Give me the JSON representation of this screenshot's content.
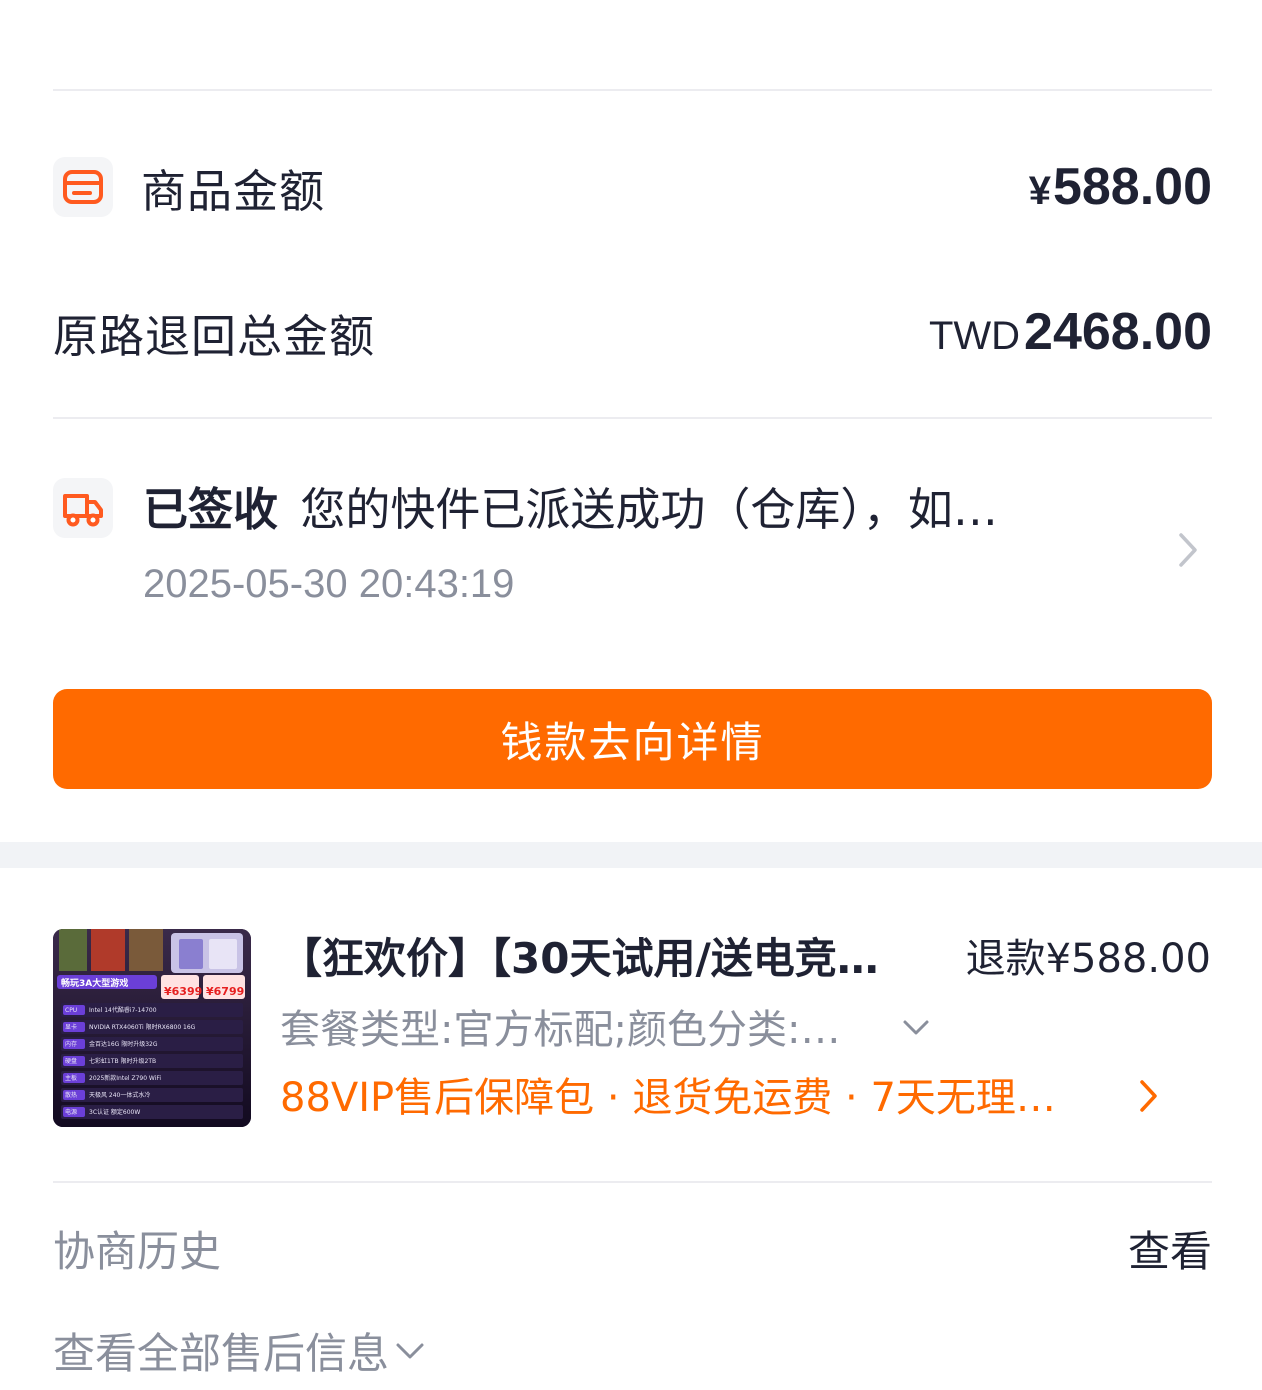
{
  "summary": {
    "goods_amount_label": "商品金额",
    "goods_amount_symbol": "¥",
    "goods_amount_value": "588.00",
    "refund_total_label": "原路退回总金额",
    "refund_total_currency": "TWD",
    "refund_total_value": "2468.00"
  },
  "logistics": {
    "status": "已签收",
    "message": "您的快件已派送成功（仓库），如…",
    "timestamp": "2025-05-30 20:43:19"
  },
  "money_flow_button": "钱款去向详情",
  "product": {
    "title": "【狂欢价】【30天试用/送电竞…",
    "refund": "退款¥588.00",
    "spec": "套餐类型:官方标配;颜色分类:配…",
    "service": "88VIP售后保障包 · 退货免运费 · 7天无理…",
    "thumbnail_text": {
      "banner": "畅玩3A大型游戏",
      "price1": "¥6399",
      "price2": "¥6799",
      "rows": [
        {
          "tag": "CPU",
          "text": "Intel 14代酷睿i7-14700"
        },
        {
          "tag": "显卡",
          "text": "NVIDIA RTX4060Ti 限时RX6800 16G"
        },
        {
          "tag": "内存",
          "text": "金百达16G 限时升级32G"
        },
        {
          "tag": "硬盘",
          "text": "七彩虹1TB 限时升级2TB"
        },
        {
          "tag": "主板",
          "text": "2025新款Intel Z790 WiFi"
        },
        {
          "tag": "散热",
          "text": "天极风 240一体式水冷"
        },
        {
          "tag": "电源",
          "text": "3C认证 额定600W"
        }
      ]
    }
  },
  "history": {
    "label": "协商历史",
    "action": "查看"
  },
  "view_all": "查看全部售后信息",
  "colors": {
    "accent": "#ff6a00",
    "text_primary": "#1f2233",
    "text_secondary": "#8a8f9c",
    "divider": "#ececf0"
  }
}
